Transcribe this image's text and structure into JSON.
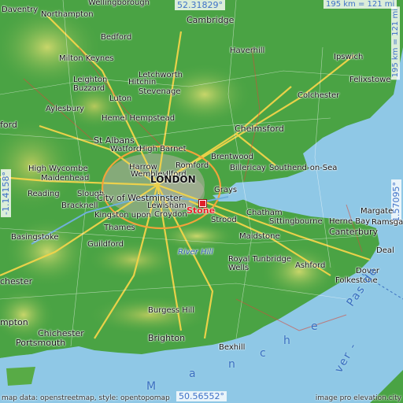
{
  "coords": {
    "north": "52.31829°",
    "south": "50.56552°",
    "west": "-1.14158°",
    "east": "1.57095°"
  },
  "scale": {
    "horizontal": "195 km = 121 mi",
    "vertical": "195 km = 121 mi"
  },
  "target": {
    "name": "Stone"
  },
  "places": {
    "daventry": "Daventry",
    "northampton": "Northampton",
    "wellingborough": "Wellingborough",
    "cambridge": "Cambridge",
    "bedford": "Bedford",
    "haverhill": "Haverhill",
    "ipswich": "Ipswich",
    "milton_keynes": "Milton Keynes",
    "letchworth": "Letchworth",
    "hitchin": "Hitchin",
    "leighton": "Leighton",
    "buzzard": "Buzzard",
    "felixstowe": "Felixstowe",
    "stevenage": "Stevenage",
    "luton": "Luton",
    "colchester": "Colchester",
    "aylesbury": "Aylesbury",
    "hemel_hempstead": "Hemel Hempstead",
    "chelmsford": "Chelmsford",
    "oxford_partial": "ford",
    "st_albans": "St Albans",
    "watford": "Watford",
    "high_barnet": "High Barnet",
    "brentwood": "Brentwood",
    "harrow": "Harrow",
    "romford": "Romford",
    "southend": "Southend-on-Sea",
    "billericay": "Billericay",
    "high_wycombe": "High Wycombe",
    "wembley": "Wembley",
    "ilford": "Ilford",
    "maidenhead": "Maidenhead",
    "london": "LONDON",
    "reading": "Reading",
    "slough": "Slough",
    "city_of_westminster": "City of Westminster",
    "grays": "Grays",
    "bracknell": "Bracknell",
    "lewisham": "Lewisham",
    "chatham": "Chatham",
    "kingston": "Kingston upon",
    "croydon": "Croydon",
    "margate": "Margate",
    "thames": "Thames",
    "strood": "Strood",
    "sittingbourne": "Sittingbourne",
    "herne_bay": "Herne Bay",
    "ramsgate": "Ramsgate",
    "basingstoke": "Basingstoke",
    "canterbury": "Canterbury",
    "guildford": "Guildford",
    "maidstone": "Maidstone",
    "deal": "Deal",
    "river_hill": "River Hill",
    "royal_tunbridge": "Royal Tunbridge",
    "wells": "Wells",
    "ashford": "Ashford",
    "dover": "Dover",
    "folkestone": "Folkestone",
    "winchester_partial": "chester",
    "burgess_hill": "Burgess Hill",
    "southampton_partial": "mpton",
    "chichester": "Chichester",
    "portsmouth": "Portsmouth",
    "brighton": "Brighton",
    "bexhill": "Bexhill"
  },
  "water": {
    "manche": [
      "M",
      "a",
      "n",
      "c",
      "h",
      "e"
    ],
    "pas_de_calais": "Pas de",
    "strait_partial": "ver -"
  },
  "credits": {
    "left": "map data: openstreetmap, style: opentopomap",
    "right": "image pro       elevation.city"
  },
  "colors": {
    "marker": "#e0202a",
    "coord_text": "#3f72c8",
    "sea": "#8fc8e6",
    "lowland": "#3f9e3c",
    "highland": "#a8c84c"
  }
}
